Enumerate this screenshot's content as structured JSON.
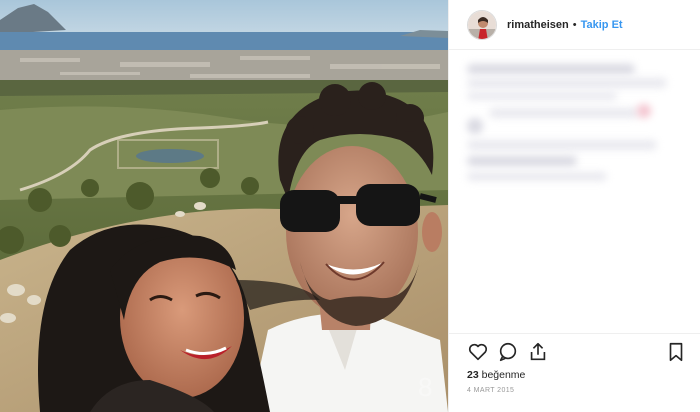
{
  "header": {
    "username": "rimatheisen",
    "separator": "•",
    "follow_label": "Takip Et"
  },
  "footer": {
    "likes_count": "23",
    "likes_word": "beğenme",
    "date": "4 MART 2015"
  },
  "icons": {
    "like": "heart-icon",
    "comment": "comment-icon",
    "share": "share-icon",
    "save": "bookmark-icon"
  },
  "colors": {
    "link_blue": "#3897f0",
    "text_dark": "#262626",
    "muted_gray": "#999999"
  }
}
